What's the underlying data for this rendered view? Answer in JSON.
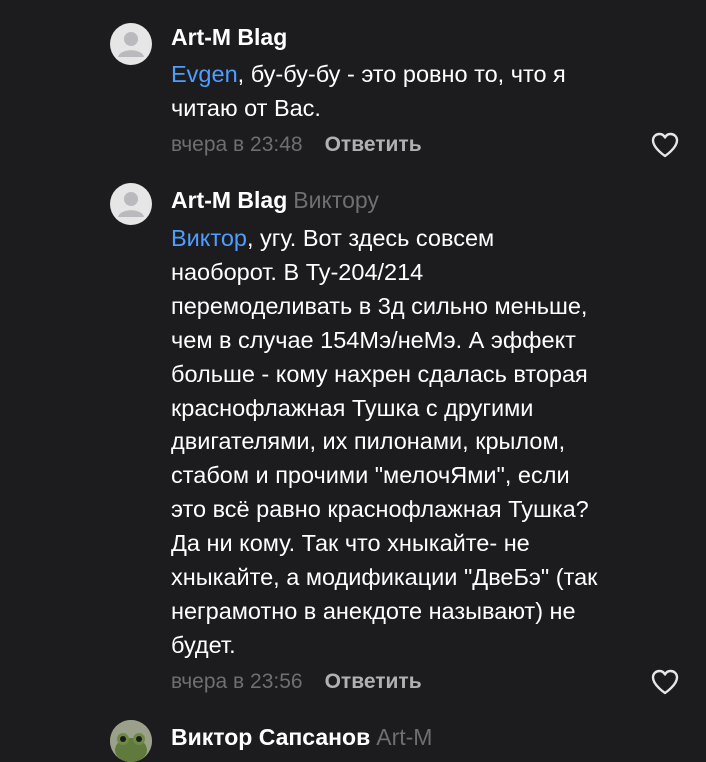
{
  "comments": [
    {
      "author": "Art-M Blag",
      "reply_to": "",
      "mention": "Evgen",
      "text": ", бу-бу-бу - это ровно то, что я\nчитаю от Вас.",
      "timestamp": "вчера в 23:48",
      "reply_label": "Ответить"
    },
    {
      "author": "Art-M Blag",
      "reply_to": "Виктору",
      "mention": "Виктор",
      "text": ", угу. Вот здесь совсем\nнаоборот. В Ту-204/214\nперемоделивать в 3д сильно меньше,\nчем в случае 154Мэ/неМэ. А эффект\nбольше - кому нахрен сдалась вторая\nкраснофлажная Тушка с другими\nдвигателями, их пилонами, крылом,\nстабом и прочими \"мелочЯми\", если\nэто всё равно краснофлажная Тушка?\nДа ни кому. Так что хныкайте- не\nхныкайте, а модификации \"ДвеБэ\" (так\nнеграмотно в анекдоте называют) не\nбудет.",
      "timestamp": "вчера в 23:56",
      "reply_label": "Ответить"
    },
    {
      "author": "Виктор Сапсанов",
      "reply_to": "Art-M"
    }
  ],
  "icons": {
    "avatar_placeholder": "user-silhouette-icon",
    "like": "heart-outline-icon",
    "avatar_photo": "frog-avatar-icon"
  },
  "colors": {
    "background": "#1c1c1e",
    "text": "#ffffff",
    "mention": "#4f9dff",
    "muted": "#6e6e73",
    "reply_button": "#b0b0b5",
    "avatar_bg": "#e6e6e6"
  }
}
